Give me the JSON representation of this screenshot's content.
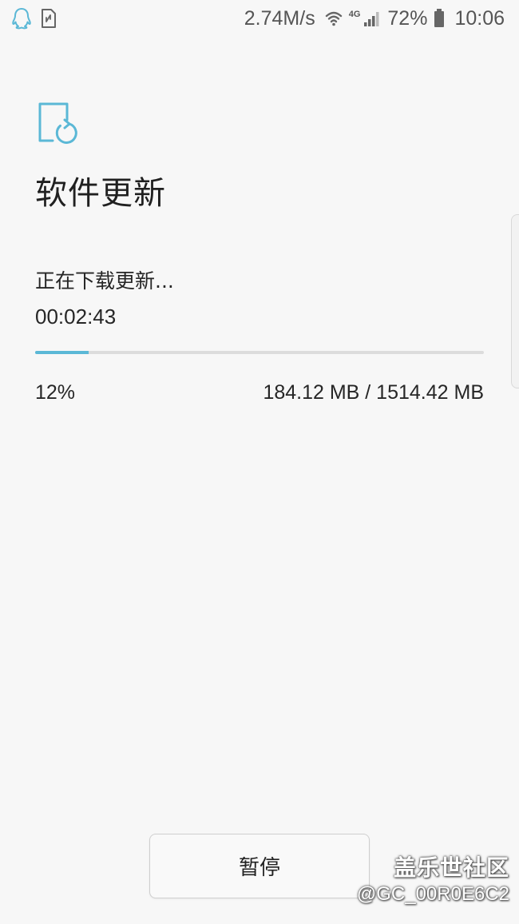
{
  "status_bar": {
    "network_speed": "2.74M/s",
    "network_type": "4G",
    "battery_percent": "72%",
    "time": "10:06",
    "left_icons": [
      "qq-penguin-icon",
      "sim-card-icon"
    ],
    "right_icons": [
      "wifi-icon",
      "cellular-signal-icon",
      "battery-icon"
    ]
  },
  "header": {
    "icon": "software-update-icon",
    "title": "软件更新"
  },
  "download": {
    "status_text": "正在下载更新...",
    "elapsed_time": "00:02:43",
    "progress_fraction": 0.12,
    "percent_label": "12%",
    "size_label": "184.12 MB / 1514.42 MB"
  },
  "actions": {
    "pause_label": "暂停"
  },
  "watermark": {
    "brand": "盖乐世社区",
    "user": "@GC_00R0E6C2"
  },
  "colors": {
    "accent": "#5bb8d6",
    "background": "#f7f7f7",
    "progress_track": "#dcdcdc"
  }
}
